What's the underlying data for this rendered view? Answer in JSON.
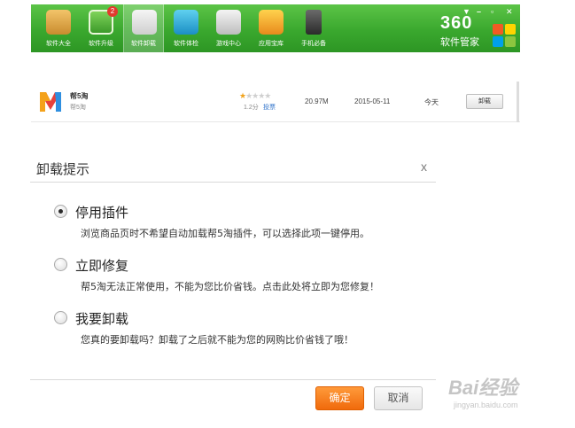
{
  "toolbar": {
    "items": [
      {
        "label": "软件大全",
        "icon": "software-box-icon"
      },
      {
        "label": "软件升级",
        "icon": "upgrade-icon",
        "badge": "2"
      },
      {
        "label": "软件卸载",
        "icon": "recycle-icon",
        "active": true
      },
      {
        "label": "软件体检",
        "icon": "check-monitor-icon"
      },
      {
        "label": "游戏中心",
        "icon": "gamepad-icon"
      },
      {
        "label": "应用宝库",
        "icon": "app-store-icon"
      },
      {
        "label": "手机必备",
        "icon": "phone-icon"
      }
    ],
    "window_controls": {
      "minimize": "–",
      "restore": "▫",
      "close": "✕",
      "menu": "▼"
    },
    "brand_number": "360",
    "brand_text": "软件管家"
  },
  "software_row": {
    "name": "帮5淘",
    "subtitle": "帮5淘",
    "rating": {
      "stars_filled": 1,
      "stars_total": 5,
      "score": "1.2分",
      "vote": "投票"
    },
    "size": "20.97M",
    "date": "2015-05-11",
    "last_used": "今天",
    "uninstall_button": "卸载"
  },
  "dialog": {
    "title": "卸载提示",
    "close": "x",
    "options": [
      {
        "title": "停用插件",
        "desc": "浏览商品页时不希望自动加载帮5淘插件，可以选择此项一键停用。",
        "checked": true
      },
      {
        "title": "立即修复",
        "desc": "帮5淘无法正常使用，不能为您比价省钱。点击此处将立即为您修复！",
        "checked": false
      },
      {
        "title": "我要卸载",
        "desc": "您真的要卸载吗？卸载了之后就不能为您的网购比价省钱了哦！",
        "checked": false
      }
    ],
    "ok_button": "确定",
    "cancel_button": "取消"
  },
  "watermark": {
    "brand": "Bai经验",
    "url": "jingyan.baidu.com"
  },
  "colors": {
    "toolbar_green": "#3aa82e",
    "ok_orange": "#f47a1a",
    "star": "#f1a31c"
  }
}
